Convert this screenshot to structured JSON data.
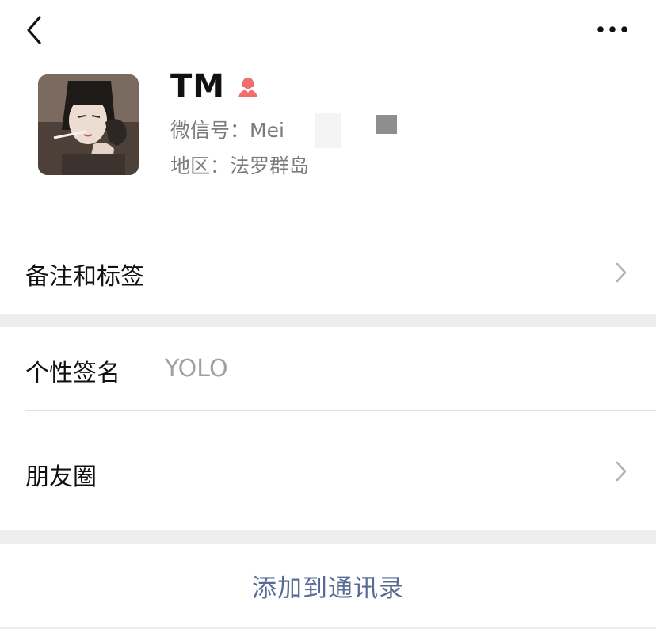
{
  "profile": {
    "name": "TM",
    "wechat_id_label": "微信号：",
    "wechat_id_value": "Mei",
    "region_label": "地区：",
    "region_value": "法罗群岛",
    "gender_icon": "female-person-icon",
    "gender_color": "#f26d6d"
  },
  "menu": {
    "remark_label": "备注和标签",
    "signature_label": "个性签名",
    "signature_value": "YOLO",
    "moments_label": "朋友圈"
  },
  "action": {
    "add_contact_label": "添加到通讯录"
  },
  "colors": {
    "link": "#576b95",
    "secondary_text": "#7b7b7b",
    "background": "#ededed"
  }
}
